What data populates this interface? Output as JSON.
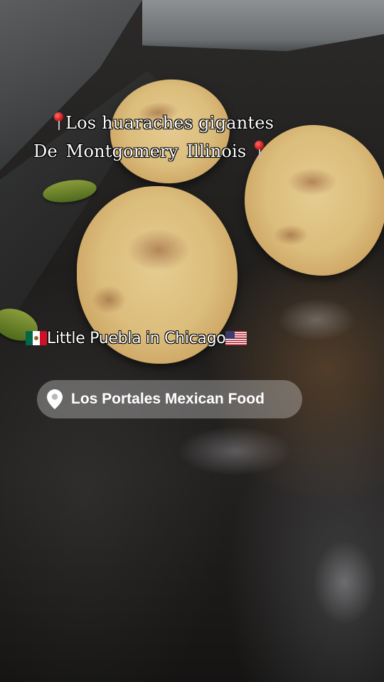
{
  "overlay": {
    "title_line1": "Los huaraches gigantes",
    "title_line2": "De  Montgomery  Illinois",
    "title_pin_icon": "round-pushpin-icon",
    "subtitle": "Little Puebla in Chicago",
    "subtitle_flags": [
      "mexico-flag-icon",
      "usa-flag-icon"
    ]
  },
  "location_tag": {
    "icon": "location-pin-icon",
    "label": "Los Portales Mexican Food"
  },
  "colors": {
    "pin_red": "#d11a1a",
    "pill_bg": "rgba(220,220,222,0.35)",
    "text": "#ffffff"
  }
}
